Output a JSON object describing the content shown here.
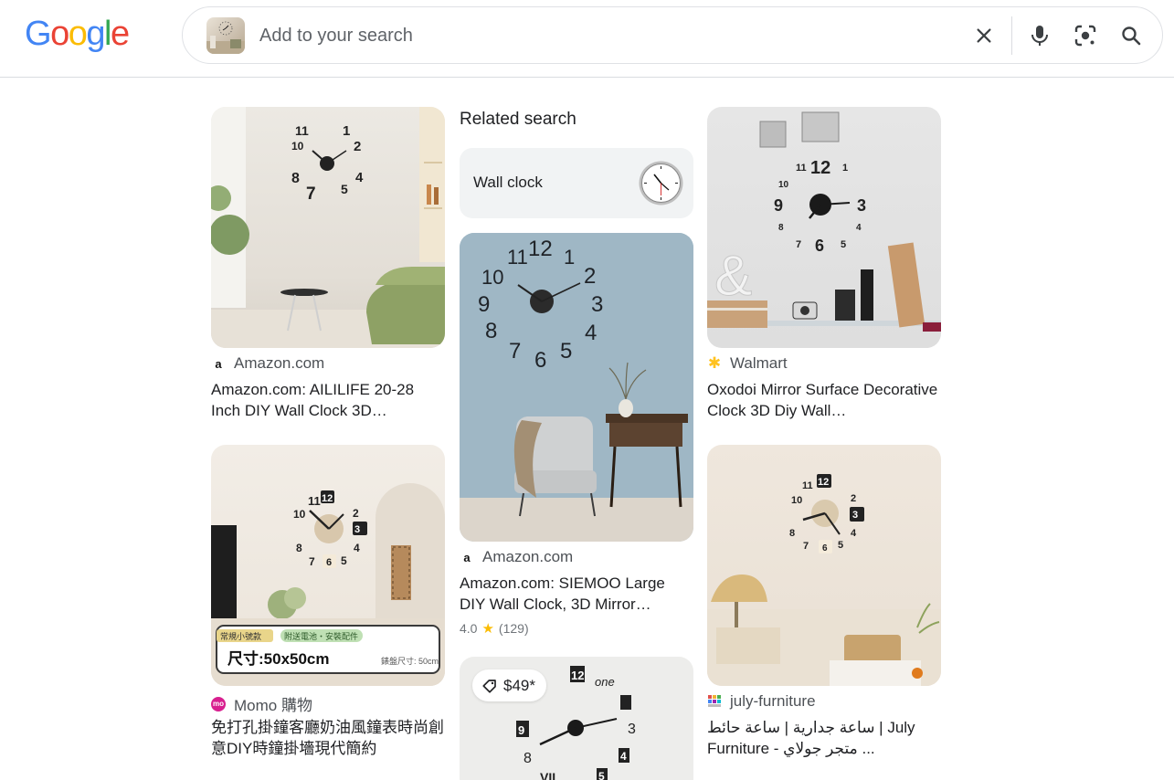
{
  "header": {
    "logo_letters": [
      "G",
      "o",
      "o",
      "g",
      "l",
      "e"
    ],
    "logo_colors": [
      "#4285F4",
      "#EA4335",
      "#FBBC05",
      "#4285F4",
      "#34A853",
      "#EA4335"
    ],
    "search": {
      "placeholder": "Add to your search",
      "value": "",
      "clear_icon": "close-icon",
      "voice_icon": "mic-icon",
      "lens_icon": "lens-icon",
      "search_icon": "search-icon"
    }
  },
  "related": {
    "heading": "Related search",
    "chips": [
      {
        "label": "Wall clock",
        "icon": "wall-clock-thumbnail"
      }
    ]
  },
  "results": [
    {
      "source": "Amazon.com",
      "favicon": "amazon-icon",
      "title": "Amazon.com: AILILIFE 20-28 Inch DIY Wall Clock 3D…",
      "clock_numbers": [
        "11",
        "1",
        "2",
        "10",
        "8",
        "4",
        "7",
        "5"
      ]
    },
    {
      "source": "Walmart",
      "favicon": "walmart-icon",
      "title": "Oxodoi Mirror Surface Decorative Clock 3D Diy Wall…",
      "clock_numbers": [
        "11",
        "12",
        "1",
        "10",
        "9",
        "3",
        "8",
        "4",
        "7",
        "6",
        "5"
      ],
      "decor_glyph": "&"
    },
    {
      "source": "Amazon.com",
      "favicon": "amazon-icon",
      "title": "Amazon.com: SIEMOO Large DIY Wall Clock, 3D Mirror…",
      "rating_value": "4.0",
      "rating_count": "(129)",
      "clock_numbers": [
        "11",
        "12",
        "1",
        "10",
        "2",
        "9",
        "3",
        "8",
        "4",
        "7",
        "6",
        "5"
      ]
    },
    {
      "source": "Momo 購物",
      "favicon": "momo-icon",
      "title": "免打孔掛鐘客廳奶油風鐘表時尚創意DIY時鐘掛墻現代簡約",
      "clock_numbers": [
        "11",
        "12",
        "2",
        "10",
        "3",
        "8",
        "4",
        "7",
        "6",
        "5"
      ],
      "banner_tags": [
        "常規小號款",
        "附送電池・安裝配件"
      ],
      "banner_size": "尺寸:50x50cm",
      "banner_note": "錶盤尺寸: 50cm"
    },
    {
      "source": "july-furniture",
      "favicon": "july-furniture-icon",
      "title_line1": "ساعة جدارية | ساعة حائط | July",
      "title_line2": "Furniture - متجر جولاي ...",
      "clock_numbers": [
        "11",
        "12",
        "10",
        "2",
        "3",
        "8",
        "4",
        "7",
        "6",
        "5"
      ]
    },
    {
      "price": "$49*",
      "price_icon": "price-tag-icon",
      "clock_numbers": [
        "12",
        "one",
        "9",
        "3",
        "8",
        "4",
        "VII",
        "5"
      ]
    }
  ],
  "colors": {
    "accent_blue": "#4285F4",
    "text_primary": "#202124",
    "text_secondary": "#4d5156",
    "chip_bg": "#f1f3f4",
    "star": "#fbbc04"
  }
}
